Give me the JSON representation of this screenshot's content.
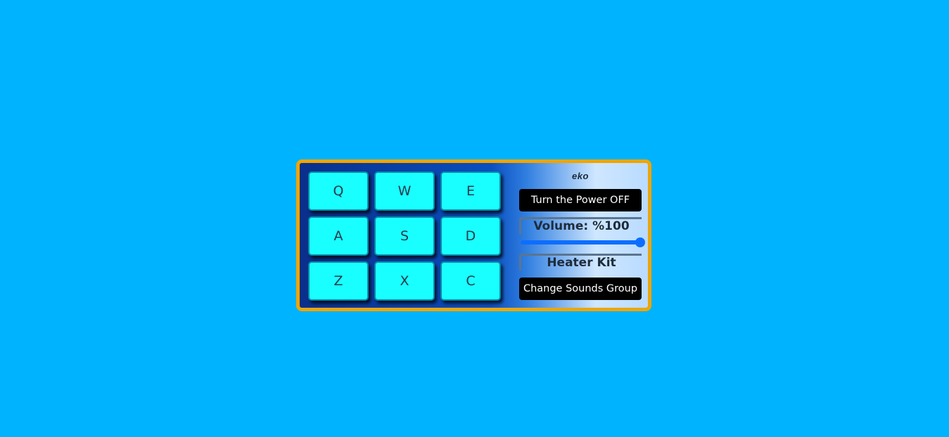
{
  "pads": [
    {
      "key": "Q"
    },
    {
      "key": "W"
    },
    {
      "key": "E"
    },
    {
      "key": "A"
    },
    {
      "key": "S"
    },
    {
      "key": "D"
    },
    {
      "key": "Z"
    },
    {
      "key": "X"
    },
    {
      "key": "C"
    }
  ],
  "controls": {
    "brand": "eko",
    "power_button_label": "Turn the Power OFF",
    "volume_display": "Volume: %100",
    "volume_level": 1.0,
    "kit_display": "Heater Kit",
    "change_sounds_label": "Change Sounds Group"
  },
  "colors": {
    "background": "#00b3ff",
    "frame_border": "#f0a500",
    "pad": "#19ffff",
    "button": "#000000",
    "slider": "#0d6efd"
  }
}
